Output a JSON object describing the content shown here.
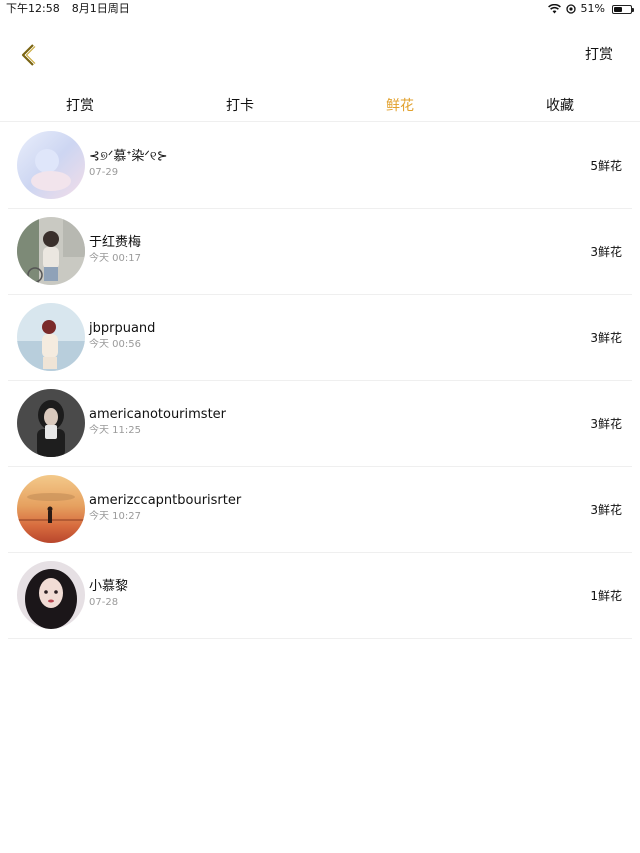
{
  "status_bar": {
    "time": "下午12:58",
    "date": "8月1日周日",
    "battery_text": "51%",
    "battery_level": 0.51
  },
  "nav": {
    "back_icon": "chevron-left-icon",
    "action_label": "打赏"
  },
  "tabs": [
    {
      "label": "打赏",
      "active": false
    },
    {
      "label": "打卡",
      "active": false
    },
    {
      "label": "鲜花",
      "active": true
    },
    {
      "label": "收藏",
      "active": false
    }
  ],
  "colors": {
    "accent": "#e2a12d",
    "muted_text": "#9a9a9a",
    "divider": "#efefef"
  },
  "list": [
    {
      "name": "⊰୭ᐟ慕ᐩ染ᐟ୧⊱",
      "time": "07-29",
      "count": "5鲜花"
    },
    {
      "name": "于红赉梅",
      "time": "今天 00:17",
      "count": "3鲜花"
    },
    {
      "name": "jbprpuand",
      "time": "今天 00:56",
      "count": "3鲜花"
    },
    {
      "name": "americanotourimster",
      "time": "今天 11:25",
      "count": "3鲜花"
    },
    {
      "name": "amerizccapntbourisrter",
      "time": "今天 10:27",
      "count": "3鲜花"
    },
    {
      "name": "小慕黎",
      "time": "07-28",
      "count": "1鲜花"
    }
  ]
}
